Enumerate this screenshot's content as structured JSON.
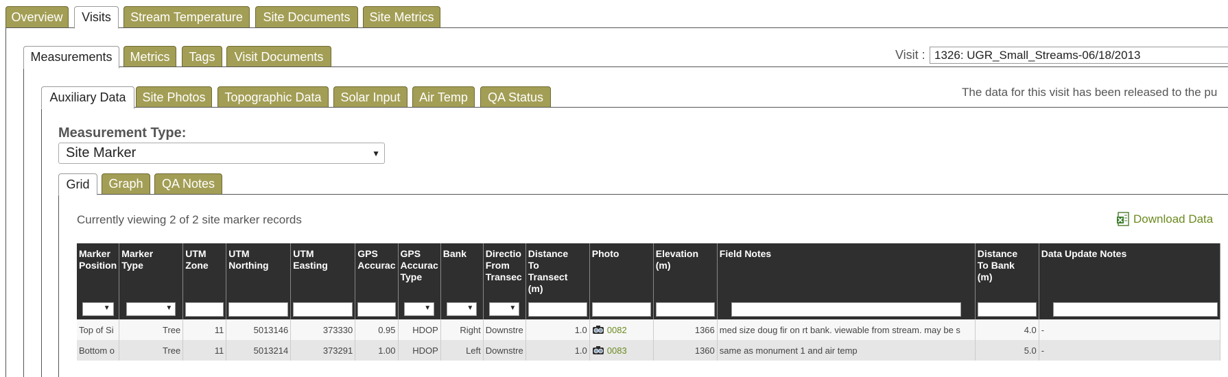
{
  "top_tabs": [
    "Overview",
    "Visits",
    "Stream Temperature",
    "Site Documents",
    "Site Metrics"
  ],
  "second_tabs": [
    "Measurements",
    "Metrics",
    "Tags",
    "Visit Documents"
  ],
  "visit": {
    "label": "Visit :",
    "value": "1326: UGR_Small_Streams-06/18/2013"
  },
  "third_tabs": [
    "Auxiliary Data",
    "Site Photos",
    "Topographic Data",
    "Solar Input",
    "Air Temp",
    "QA Status"
  ],
  "release_note": "The data for this visit has been released to the pu",
  "measurement_type": {
    "label": "Measurement Type:",
    "value": "Site Marker"
  },
  "view_tabs": [
    "Grid",
    "Graph",
    "QA Notes"
  ],
  "viewing_text": "Currently viewing 2 of 2 site marker records",
  "download_label": "Download Data",
  "columns": [
    [
      "Marker",
      "Position"
    ],
    [
      "Marker",
      "Type"
    ],
    [
      "UTM",
      "Zone"
    ],
    [
      "UTM",
      "Northing"
    ],
    [
      "UTM",
      "Easting"
    ],
    [
      "GPS",
      "Accurac"
    ],
    [
      "GPS",
      "Accurac",
      "Type"
    ],
    [
      "Bank"
    ],
    [
      "Directio",
      "From",
      "Transec"
    ],
    [
      "Distance",
      "To",
      "Transect",
      "(m)"
    ],
    [
      "Photo"
    ],
    [
      "Elevation",
      "(m)"
    ],
    [
      "Field Notes"
    ],
    [
      "Distance",
      "To Bank",
      "(m)"
    ],
    [
      "Data Update Notes"
    ]
  ],
  "rows": [
    [
      "Top of Si",
      "Tree",
      "11",
      "5013146",
      "373330",
      "0.95",
      "HDOP",
      "Right",
      "Downstre",
      "1.0",
      "0082",
      "1366",
      "med size doug fir on rt bank. viewable from stream. may be s",
      "4.0",
      "-"
    ],
    [
      "Bottom o",
      "Tree",
      "11",
      "5013214",
      "373291",
      "1.00",
      "HDOP",
      "Left",
      "Downstre",
      "1.0",
      "0083",
      "1360",
      "same as monument 1 and air temp",
      "5.0",
      "-"
    ]
  ],
  "icons": {
    "camera": "camera-icon",
    "excel": "excel-file-icon",
    "dropdown": "chevron-down-icon"
  },
  "colors": {
    "tab": "#a39e55",
    "header": "#2f2f2f",
    "link": "#6b8a1f"
  }
}
